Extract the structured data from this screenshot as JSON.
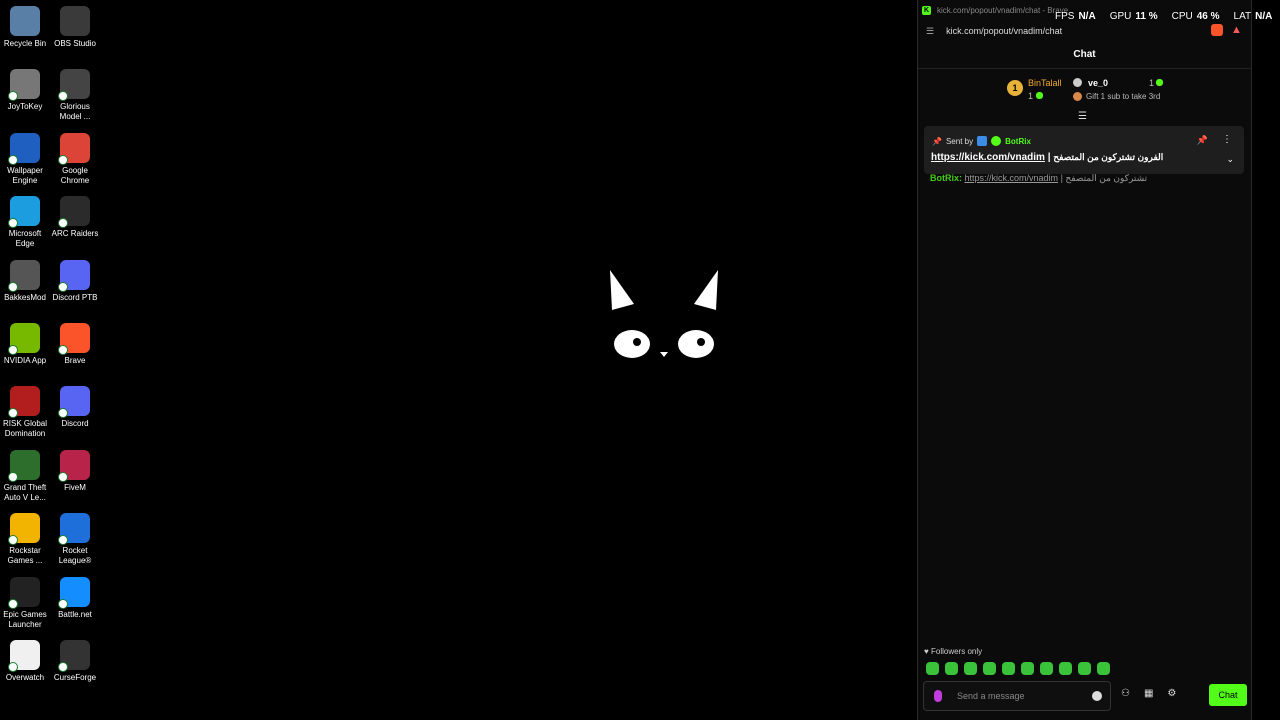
{
  "desktop": {
    "icons": [
      {
        "label": "Recycle Bin",
        "icon": "recycle-bin-icon",
        "color": "#5a7fa6"
      },
      {
        "label": "OBS Studio",
        "icon": "obs-icon",
        "color": "#3a3a3a"
      },
      {
        "label": "JoyToKey",
        "icon": "joytokey-icon",
        "color": "#777777"
      },
      {
        "label": "Glorious\nModel ...",
        "icon": "mouse-icon",
        "color": "#444444"
      },
      {
        "label": "Wallpaper\nEngine",
        "icon": "wallpaper-engine-icon",
        "color": "#1f5fbf"
      },
      {
        "label": "Google\nChrome",
        "icon": "chrome-icon",
        "color": "#db4437"
      },
      {
        "label": "Microsoft\nEdge",
        "icon": "edge-icon",
        "color": "#1b9de0"
      },
      {
        "label": "ARC Raiders",
        "icon": "arc-raiders-icon",
        "color": "#2b2b2b"
      },
      {
        "label": "BakkesMod",
        "icon": "bakkesmod-icon",
        "color": "#555555"
      },
      {
        "label": "Discord PTB",
        "icon": "discord-icon",
        "color": "#5865f2"
      },
      {
        "label": "NVIDIA App",
        "icon": "nvidia-icon",
        "color": "#76b900"
      },
      {
        "label": "Brave",
        "icon": "brave-icon",
        "color": "#fb542b"
      },
      {
        "label": "RISK Global\nDomination",
        "icon": "risk-icon",
        "color": "#b21e1e"
      },
      {
        "label": "Discord",
        "icon": "discord-icon",
        "color": "#5865f2"
      },
      {
        "label": "Grand Theft\nAuto V Le...",
        "icon": "gta-icon",
        "color": "#2d6e2d"
      },
      {
        "label": "FiveM",
        "icon": "fivem-icon",
        "color": "#b8234a"
      },
      {
        "label": "Rockstar\nGames ...",
        "icon": "rockstar-icon",
        "color": "#f2b400"
      },
      {
        "label": "Rocket\nLeague®",
        "icon": "rocket-league-icon",
        "color": "#1e6fd9"
      },
      {
        "label": "Epic Games\nLauncher",
        "icon": "epic-games-icon",
        "color": "#222222"
      },
      {
        "label": "Battle.net",
        "icon": "battlenet-icon",
        "color": "#148eff"
      },
      {
        "label": "Overwatch",
        "icon": "overwatch-icon",
        "color": "#f0f0f0"
      },
      {
        "label": "CurseForge",
        "icon": "curseforge-icon",
        "color": "#333333"
      }
    ]
  },
  "overlay": {
    "fps_label": "FPS",
    "fps_value": "N/A",
    "gpu_label": "GPU",
    "gpu_value": "11 %",
    "cpu_label": "CPU",
    "cpu_value": "46 %",
    "lat_label": "LAT",
    "lat_value": "N/A"
  },
  "browser": {
    "title": "kick.com/popout/vnadim/chat - Brave",
    "url": "kick.com/popout/vnadim/chat"
  },
  "chat": {
    "header": "Chat",
    "leaderboard": {
      "first_name": "BinTalall",
      "first_count": "1",
      "second_name": "ve_0",
      "second_count": "1",
      "gift_text": "Gift 1 sub to take 3rd"
    },
    "pinned": {
      "sent_by": "Sent by",
      "sender": "BotRix",
      "link": "https://kick.com/vnadim",
      "separator": "|",
      "arabic": "الفرون تشتركون من المتصفح"
    },
    "message": {
      "user": "BotRix:",
      "link": "https://kick.com/vnadim",
      "separator": "|",
      "arabic": "تشتركون من المتصفح"
    },
    "followers_only": "Followers only",
    "input_placeholder": "Send a message",
    "send_label": "Chat",
    "accent": "#53fc18"
  }
}
